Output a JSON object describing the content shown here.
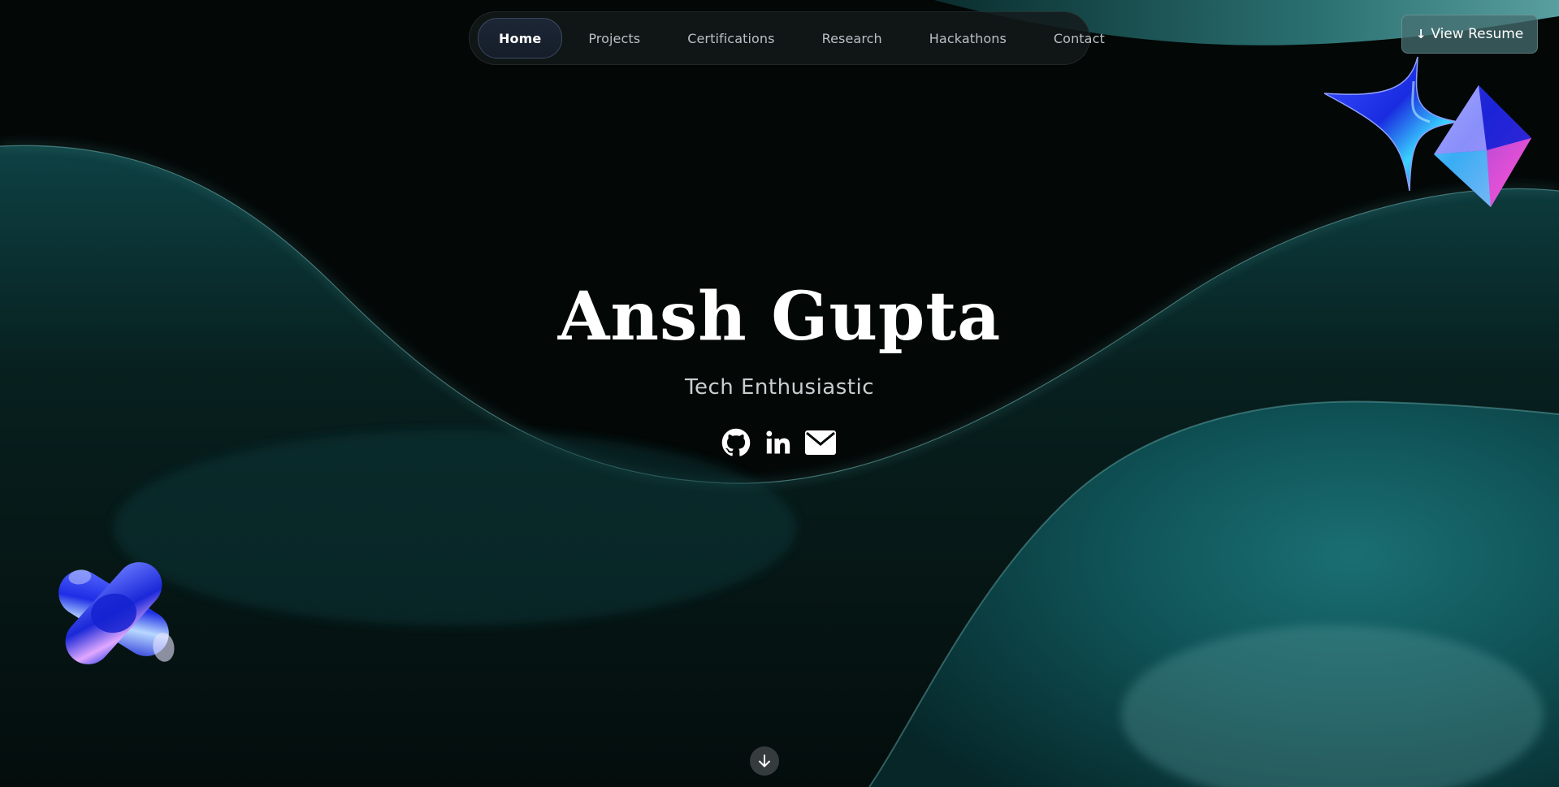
{
  "nav": {
    "items": [
      {
        "label": "Home",
        "active": true
      },
      {
        "label": "Projects",
        "active": false
      },
      {
        "label": "Certifications",
        "active": false
      },
      {
        "label": "Research",
        "active": false
      },
      {
        "label": "Hackathons",
        "active": false
      },
      {
        "label": "Contact",
        "active": false
      }
    ]
  },
  "resume": {
    "label": "View Resume",
    "icon": "download-arrow-icon"
  },
  "hero": {
    "name": "Ansh Gupta",
    "tagline": "Tech Enthusiastic"
  },
  "socials": [
    {
      "icon": "github-icon"
    },
    {
      "icon": "linkedin-icon"
    },
    {
      "icon": "email-icon"
    }
  ],
  "scroll": {
    "icon": "arrow-down-icon"
  },
  "decorations": [
    {
      "icon": "sparkle-star-icon"
    },
    {
      "icon": "octahedron-crystal-icon"
    },
    {
      "icon": "x-shape-icon"
    }
  ],
  "colors": {
    "background": "#030807",
    "wave_teal": "#0f5e62",
    "wave_highlight": "#6fa9aa",
    "accent_blue": "#2430e0"
  }
}
